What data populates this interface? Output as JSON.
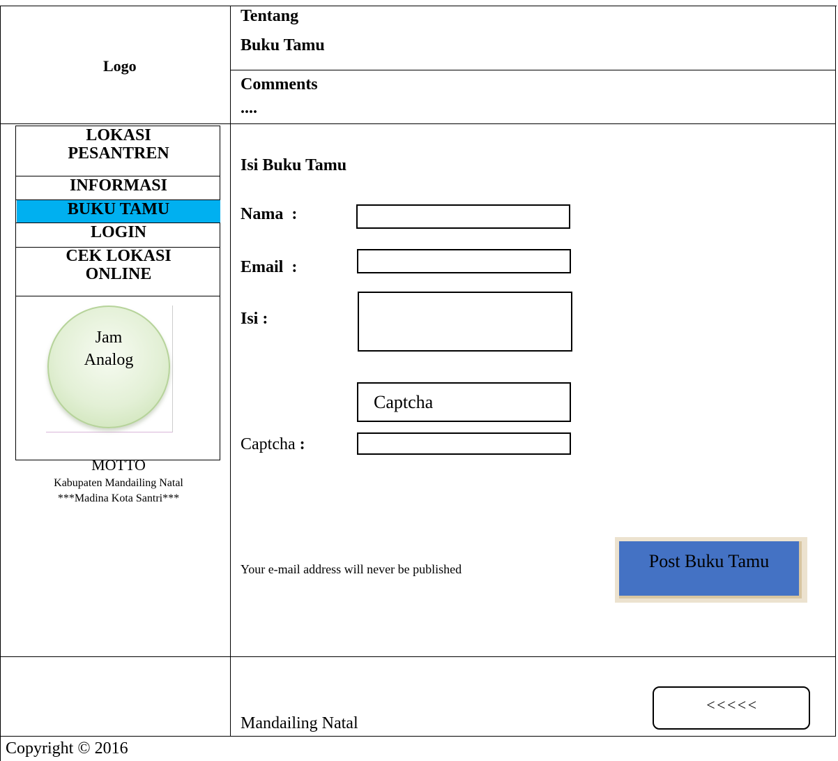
{
  "header": {
    "logo_text": "Logo",
    "nav": [
      "Tentang",
      "Buku Tamu",
      "Comments",
      "...."
    ]
  },
  "sidebar": {
    "menu": [
      {
        "label": "LOKASI\nPESANTREN",
        "active": false
      },
      {
        "label": "INFORMASI",
        "active": false
      },
      {
        "label": "BUKU TAMU",
        "active": true
      },
      {
        "label": "LOGIN",
        "active": false
      },
      {
        "label": "CEK LOKASI\nONLINE",
        "active": false
      }
    ],
    "clock_label_1": "Jam",
    "clock_label_2": "Analog",
    "motto_title": "MOTTO",
    "motto_line_1": "Kabupaten Mandailing Natal",
    "motto_line_2": "***Madina Kota Santri***",
    "active_color": "#00b0f0"
  },
  "form": {
    "title": "Isi Buku Tamu",
    "nama_label": "Nama  :",
    "email_label": "Email  :",
    "isi_label": "Isi :",
    "captcha_image_text": "Captcha",
    "captcha_label": "Captcha",
    "captcha_colon": ":",
    "nama_value": "",
    "email_value": "",
    "isi_value": "",
    "captcha_value": "",
    "note": "Your e-mail address will never be published",
    "submit_label": "Post Buku Tamu",
    "submit_color": "#4472c4"
  },
  "footer": {
    "back_label": "<<<<<",
    "location": "Mandailing Natal",
    "copyright": "Copyright © 2016"
  }
}
